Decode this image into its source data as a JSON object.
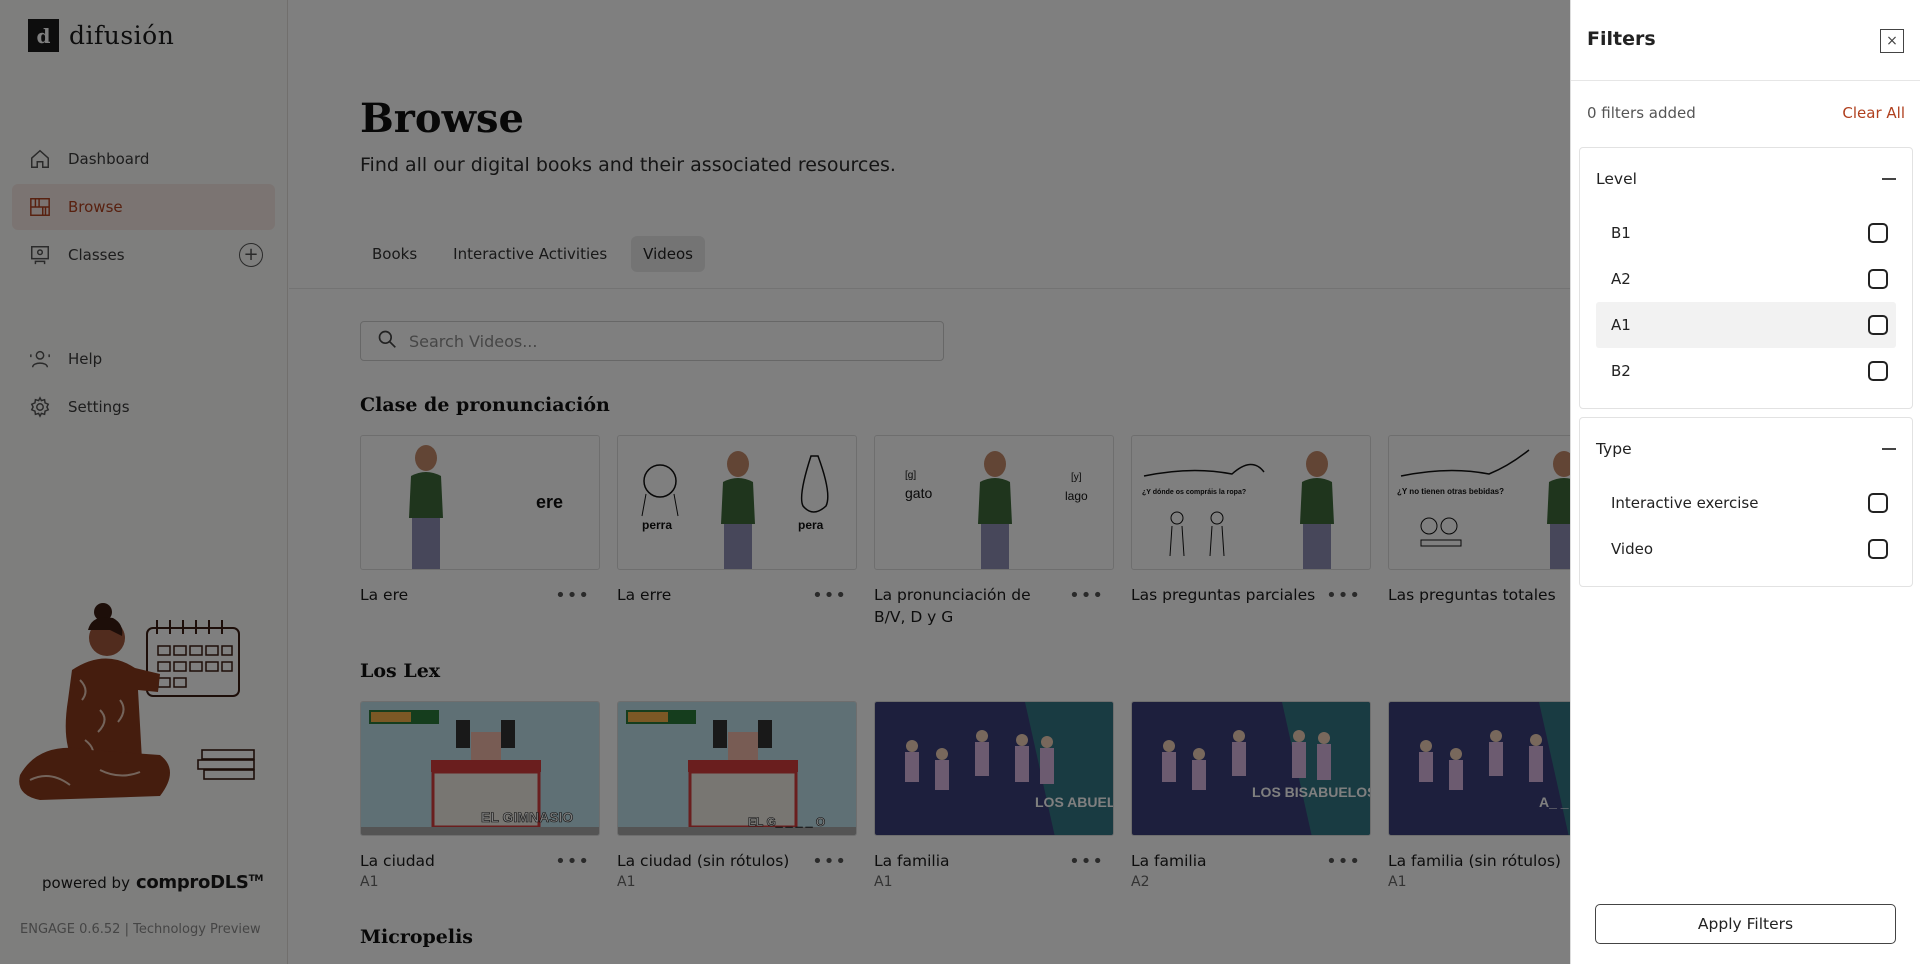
{
  "brand": {
    "logo_mark": "d",
    "name": "difusión"
  },
  "sidebar": {
    "items": [
      {
        "label": "Dashboard",
        "icon": "home-icon"
      },
      {
        "label": "Browse",
        "icon": "bookshelf-icon",
        "active": true
      },
      {
        "label": "Classes",
        "icon": "classroom-icon",
        "add": "+"
      },
      {
        "label": "Help",
        "icon": "help-person-icon"
      },
      {
        "label": "Settings",
        "icon": "gear-icon"
      }
    ],
    "powered_by": "powered by",
    "powered_brand": "comproDLS",
    "powered_tm": "TM",
    "version": "ENGAGE 0.6.52 | Technology Preview"
  },
  "main": {
    "title": "Browse",
    "subtitle": "Find all our digital books and their associated resources.",
    "tabs": [
      {
        "label": "Books"
      },
      {
        "label": "Interactive Activities"
      },
      {
        "label": "Videos",
        "active": true
      }
    ],
    "search_placeholder": "Search Videos...",
    "sections": [
      {
        "title": "Clase de pronunciación",
        "cards": [
          {
            "title": "La ere",
            "thumb_text": [
              "ere"
            ]
          },
          {
            "title": "La erre",
            "thumb_text": [
              "perra",
              "pera"
            ]
          },
          {
            "title": "La pronunciación de B/V, D y G",
            "thumb_text": [
              "[g]",
              "gato",
              "[y]",
              "lago"
            ]
          },
          {
            "title": "Las preguntas parciales",
            "thumb_text": [
              "¿Y dónde os compráis la ropa?"
            ]
          },
          {
            "title": "Las preguntas totales",
            "thumb_text": [
              "¿Y no tienen otras bebidas?"
            ]
          }
        ]
      },
      {
        "title": "Los Lex",
        "cards": [
          {
            "title": "La ciudad",
            "level": "A1",
            "thumb_text": [
              "EL GIMNASIO"
            ]
          },
          {
            "title": "La ciudad (sin rótulos)",
            "level": "A1",
            "thumb_text": [
              "EL G_ _ _ _ O"
            ]
          },
          {
            "title": "La familia",
            "level": "A1",
            "thumb_text": [
              "LOS ABUELOS"
            ]
          },
          {
            "title": "La familia",
            "level": "A2",
            "thumb_text": [
              "LOS BISABUELOS"
            ]
          },
          {
            "title": "La familia (sin rótulos)",
            "level": "A1",
            "thumb_text": [
              "A_ _ _ _S"
            ]
          }
        ]
      },
      {
        "title": "Micropelis"
      }
    ],
    "card_menu": "•••"
  },
  "filters": {
    "title": "Filters",
    "close": "×",
    "count_text": "0 filters added",
    "clear_all": "Clear All",
    "groups": [
      {
        "label": "Level",
        "options": [
          "B1",
          "A2",
          "A1",
          "B2"
        ]
      },
      {
        "label": "Type",
        "options": [
          "Interactive exercise",
          "Video"
        ]
      }
    ],
    "apply": "Apply Filters"
  },
  "colors": {
    "accent": "#b0401e",
    "active_bg": "#f6e9e4",
    "overlay": "rgba(0,0,0,0.5)"
  }
}
